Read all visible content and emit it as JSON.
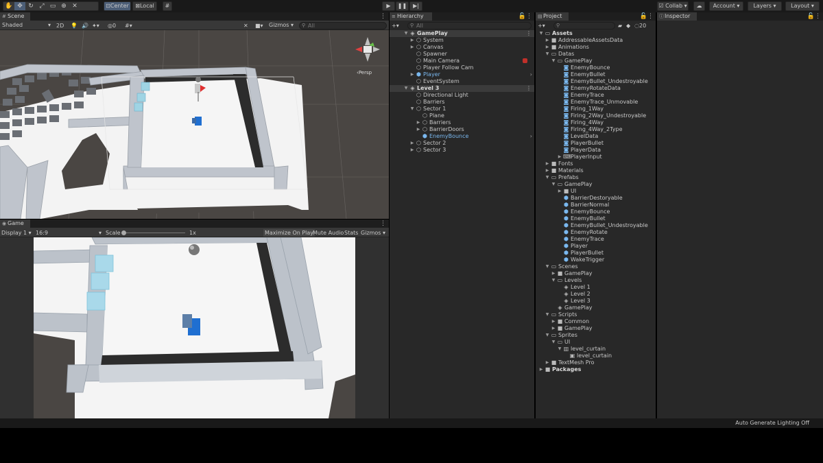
{
  "toolbar": {
    "pivot_label": "Center",
    "space_label": "Local",
    "collab_label": "Collab",
    "account_label": "Account",
    "layers_label": "Layers",
    "layout_label": "Layout"
  },
  "scene": {
    "tab": "Scene",
    "shading": "Shaded",
    "mode_2d": "2D",
    "hidden_count": "0",
    "gizmos": "Gizmos",
    "search_placeholder": "All",
    "persp_label": "Persp"
  },
  "game": {
    "tab": "Game",
    "display": "Display 1",
    "aspect": "16:9",
    "scale_label": "Scale",
    "scale_value": "1x",
    "maximize": "Maximize On Play",
    "mute": "Mute Audio",
    "stats": "Stats",
    "gizmos": "Gizmos"
  },
  "hierarchy": {
    "tab": "Hierarchy",
    "search_placeholder": "All",
    "items": [
      {
        "label": "GamePlay",
        "depth": 0,
        "arrow": "down",
        "icon": "unity-scene-icon",
        "header": true
      },
      {
        "label": "System",
        "depth": 1,
        "arrow": "right",
        "icon": "cube-icon"
      },
      {
        "label": "Canvas",
        "depth": 1,
        "arrow": "right",
        "icon": "cube-icon"
      },
      {
        "label": "Spawner",
        "depth": 1,
        "arrow": "",
        "icon": "cube-icon"
      },
      {
        "label": "Main Camera",
        "depth": 1,
        "arrow": "",
        "icon": "cube-icon",
        "badge": "red"
      },
      {
        "label": "Player Follow Cam",
        "depth": 1,
        "arrow": "",
        "icon": "cube-icon"
      },
      {
        "label": "Player",
        "depth": 1,
        "arrow": "right",
        "icon": "prefab-icon",
        "blue": true,
        "chevron": true
      },
      {
        "label": "EventSystem",
        "depth": 1,
        "arrow": "",
        "icon": "cube-icon"
      },
      {
        "label": "Level 3",
        "depth": 0,
        "arrow": "down",
        "icon": "unity-scene-icon",
        "header": true
      },
      {
        "label": "Directional Light",
        "depth": 1,
        "arrow": "",
        "icon": "cube-icon"
      },
      {
        "label": "Barriers",
        "depth": 1,
        "arrow": "",
        "icon": "cube-icon"
      },
      {
        "label": "Sector 1",
        "depth": 1,
        "arrow": "down",
        "icon": "cube-icon"
      },
      {
        "label": "Plane",
        "depth": 2,
        "arrow": "",
        "icon": "cube-icon"
      },
      {
        "label": "Barriers",
        "depth": 2,
        "arrow": "right",
        "icon": "cube-icon"
      },
      {
        "label": "BarrierDoors",
        "depth": 2,
        "arrow": "right",
        "icon": "cube-icon"
      },
      {
        "label": "EnemyBounce",
        "depth": 2,
        "arrow": "",
        "icon": "prefab-icon",
        "blue": true,
        "chevron": true
      },
      {
        "label": "Sector 2",
        "depth": 1,
        "arrow": "right",
        "icon": "cube-icon"
      },
      {
        "label": "Sector 3",
        "depth": 1,
        "arrow": "right",
        "icon": "cube-icon"
      }
    ]
  },
  "project": {
    "tab": "Project",
    "count": "20",
    "items": [
      {
        "label": "Assets",
        "depth": 0,
        "arrow": "down",
        "icon": "folder-open-icon",
        "bold": true
      },
      {
        "label": "AddressableAssetsData",
        "depth": 1,
        "arrow": "right",
        "icon": "folder-icon"
      },
      {
        "label": "Animations",
        "depth": 1,
        "arrow": "right",
        "icon": "folder-icon"
      },
      {
        "label": "Datas",
        "depth": 1,
        "arrow": "down",
        "icon": "folder-open-icon"
      },
      {
        "label": "GamePlay",
        "depth": 2,
        "arrow": "down",
        "icon": "folder-open-icon"
      },
      {
        "label": "EnemyBounce",
        "depth": 3,
        "arrow": "",
        "icon": "scriptable-icon"
      },
      {
        "label": "EnemyBullet",
        "depth": 3,
        "arrow": "",
        "icon": "scriptable-icon"
      },
      {
        "label": "EnemyBullet_Undestroyable",
        "depth": 3,
        "arrow": "",
        "icon": "scriptable-icon"
      },
      {
        "label": "EnemyRotateData",
        "depth": 3,
        "arrow": "",
        "icon": "scriptable-icon"
      },
      {
        "label": "EnemyTrace",
        "depth": 3,
        "arrow": "",
        "icon": "scriptable-icon"
      },
      {
        "label": "EnemyTrace_Unmovable",
        "depth": 3,
        "arrow": "",
        "icon": "scriptable-icon"
      },
      {
        "label": "Firing_1Way",
        "depth": 3,
        "arrow": "",
        "icon": "scriptable-icon"
      },
      {
        "label": "Firing_2Way_Undestroyable",
        "depth": 3,
        "arrow": "",
        "icon": "scriptable-icon"
      },
      {
        "label": "Firing_4Way",
        "depth": 3,
        "arrow": "",
        "icon": "scriptable-icon"
      },
      {
        "label": "Firing_4Way_2Type",
        "depth": 3,
        "arrow": "",
        "icon": "scriptable-icon"
      },
      {
        "label": "LevelData",
        "depth": 3,
        "arrow": "",
        "icon": "scriptable-icon"
      },
      {
        "label": "PlayerBullet",
        "depth": 3,
        "arrow": "",
        "icon": "scriptable-icon"
      },
      {
        "label": "PlayerData",
        "depth": 3,
        "arrow": "",
        "icon": "scriptable-icon"
      },
      {
        "label": "PlayerInput",
        "depth": 3,
        "arrow": "right",
        "icon": "input-icon"
      },
      {
        "label": "Fonts",
        "depth": 1,
        "arrow": "right",
        "icon": "folder-icon"
      },
      {
        "label": "Materials",
        "depth": 1,
        "arrow": "right",
        "icon": "folder-icon"
      },
      {
        "label": "Prefabs",
        "depth": 1,
        "arrow": "down",
        "icon": "folder-open-icon"
      },
      {
        "label": "GamePlay",
        "depth": 2,
        "arrow": "down",
        "icon": "folder-open-icon"
      },
      {
        "label": "UI",
        "depth": 3,
        "arrow": "right",
        "icon": "folder-icon"
      },
      {
        "label": "BarrierDestoryable",
        "depth": 3,
        "arrow": "",
        "icon": "prefab-icon"
      },
      {
        "label": "BarrierNormal",
        "depth": 3,
        "arrow": "",
        "icon": "prefab-icon"
      },
      {
        "label": "EnemyBounce",
        "depth": 3,
        "arrow": "",
        "icon": "prefab-icon"
      },
      {
        "label": "EnemyBullet",
        "depth": 3,
        "arrow": "",
        "icon": "prefab-icon"
      },
      {
        "label": "EnemyBullet_Undestroyable",
        "depth": 3,
        "arrow": "",
        "icon": "prefab-icon"
      },
      {
        "label": "EnemyRotate",
        "depth": 3,
        "arrow": "",
        "icon": "prefab-icon"
      },
      {
        "label": "EnemyTrace",
        "depth": 3,
        "arrow": "",
        "icon": "prefab-icon"
      },
      {
        "label": "Player",
        "depth": 3,
        "arrow": "",
        "icon": "prefab-icon"
      },
      {
        "label": "PlayerBullet",
        "depth": 3,
        "arrow": "",
        "icon": "prefab-icon"
      },
      {
        "label": "WakeTrigger",
        "depth": 3,
        "arrow": "",
        "icon": "prefab-icon"
      },
      {
        "label": "Scenes",
        "depth": 1,
        "arrow": "down",
        "icon": "folder-open-icon"
      },
      {
        "label": "GamePlay",
        "depth": 2,
        "arrow": "right",
        "icon": "folder-icon"
      },
      {
        "label": "Levels",
        "depth": 2,
        "arrow": "down",
        "icon": "folder-open-icon"
      },
      {
        "label": "Level 1",
        "depth": 3,
        "arrow": "",
        "icon": "unity-scene-icon"
      },
      {
        "label": "Level 2",
        "depth": 3,
        "arrow": "",
        "icon": "unity-scene-icon"
      },
      {
        "label": "Level 3",
        "depth": 3,
        "arrow": "",
        "icon": "unity-scene-icon"
      },
      {
        "label": "GamePlay",
        "depth": 2,
        "arrow": "",
        "icon": "unity-scene-icon"
      },
      {
        "label": "Scripts",
        "depth": 1,
        "arrow": "down",
        "icon": "folder-open-icon"
      },
      {
        "label": "Common",
        "depth": 2,
        "arrow": "right",
        "icon": "folder-icon"
      },
      {
        "label": "GamePlay",
        "depth": 2,
        "arrow": "right",
        "icon": "folder-icon"
      },
      {
        "label": "Sprites",
        "depth": 1,
        "arrow": "down",
        "icon": "folder-open-icon"
      },
      {
        "label": "UI",
        "depth": 2,
        "arrow": "down",
        "icon": "folder-open-icon"
      },
      {
        "label": "level_curtain",
        "depth": 3,
        "arrow": "down",
        "icon": "texture-icon"
      },
      {
        "label": "level_curtain",
        "depth": 4,
        "arrow": "",
        "icon": "sprite-icon"
      },
      {
        "label": "TextMesh Pro",
        "depth": 1,
        "arrow": "right",
        "icon": "folder-icon"
      },
      {
        "label": "Packages",
        "depth": 0,
        "arrow": "right",
        "icon": "folder-icon",
        "bold": true
      }
    ]
  },
  "inspector": {
    "tab": "Inspector"
  },
  "status": {
    "text": "Auto Generate Lighting Off"
  },
  "colors": {
    "accent_blue": "#7ab8ef",
    "panel": "#282828",
    "toolbar": "#191919",
    "play_blue": "#2a78d4"
  }
}
